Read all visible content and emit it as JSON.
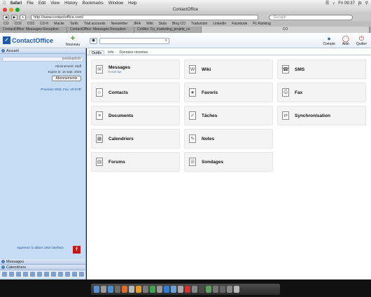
{
  "menubar": {
    "apple": "",
    "app": "Safari",
    "items": [
      "File",
      "Edit",
      "View",
      "History",
      "Bookmarks",
      "Window",
      "Help"
    ],
    "clock": "Fri 09:37",
    "user": "jb"
  },
  "window": {
    "title": "ContactOffice"
  },
  "browser": {
    "url": "http://www.contactoffice.com/",
    "search_placeholder": "Google",
    "bookmarks": [
      "CO",
      "CO2",
      "CO3",
      "CO-fr",
      "MaiJie",
      "Tarifs",
      "Trial accounts",
      "Newsletter",
      "JIRA",
      "Wiki",
      "Stats",
      "Blog CO",
      "Traduction",
      "LinkedIn",
      "Facebook",
      "Pc Ranking"
    ],
    "tabs": [
      "ContactOffice: Messages Reception",
      "ContactOffice: Messages Reception",
      "CoWiki: Co_marketing_projets_co",
      "CO"
    ]
  },
  "header": {
    "logo": "ContactOffice",
    "new_label": "Nouveau",
    "search_icon_label": "⌕",
    "buttons": [
      {
        "label": "Compte"
      },
      {
        "label": "Aide"
      },
      {
        "label": "Quitter"
      }
    ]
  },
  "sidebar": {
    "section": "Accueil",
    "username": "jeanbaptiste",
    "subscription": "Abonnement: Staff",
    "expiry": "Expire le: 15 sept. 2028",
    "subs_button": "Abonnements",
    "provision": "Provision SMS, Fax: 10 EUR",
    "learn_link": "Apprenez à utiliser cette interface",
    "footer_sections": [
      "Messages",
      "Calendriers"
    ]
  },
  "main": {
    "tabs": [
      "Outils",
      "Info",
      "Données récentes"
    ],
    "tools": [
      {
        "label": "Messages",
        "sub": "0 non-lus",
        "icon": "envelope-icon",
        "glyph": "✉"
      },
      {
        "label": "Wiki",
        "sub": "",
        "icon": "wiki-icon",
        "glyph": "W"
      },
      {
        "label": "SMS",
        "sub": "",
        "icon": "phone-icon",
        "glyph": "☎"
      },
      {
        "label": "Contacts",
        "sub": "",
        "icon": "contacts-icon",
        "glyph": "☺"
      },
      {
        "label": "Favoris",
        "sub": "",
        "icon": "bookmark-icon",
        "glyph": "★"
      },
      {
        "label": "Fax",
        "sub": "",
        "icon": "fax-icon",
        "glyph": "⎙"
      },
      {
        "label": "Documents",
        "sub": "",
        "icon": "document-icon",
        "glyph": "≡"
      },
      {
        "label": "Tâches",
        "sub": "",
        "icon": "tasks-icon",
        "glyph": "✓"
      },
      {
        "label": "Synchronisation",
        "sub": "",
        "icon": "sync-icon",
        "glyph": "⇄"
      },
      {
        "label": "Calendriers",
        "sub": "",
        "icon": "calendar-icon",
        "glyph": "▦"
      },
      {
        "label": "Notes",
        "sub": "",
        "icon": "notes-icon",
        "glyph": "✎"
      },
      {
        "label": "Forums",
        "sub": "",
        "icon": "forum-icon",
        "glyph": "▤"
      },
      {
        "label": "Sondages",
        "sub": "",
        "icon": "poll-icon",
        "glyph": "☰"
      }
    ]
  },
  "colors": {
    "sidebar_bg": "#c6dcf5",
    "accent": "#1f5aa8",
    "card_bg": "#f4f4f4"
  }
}
